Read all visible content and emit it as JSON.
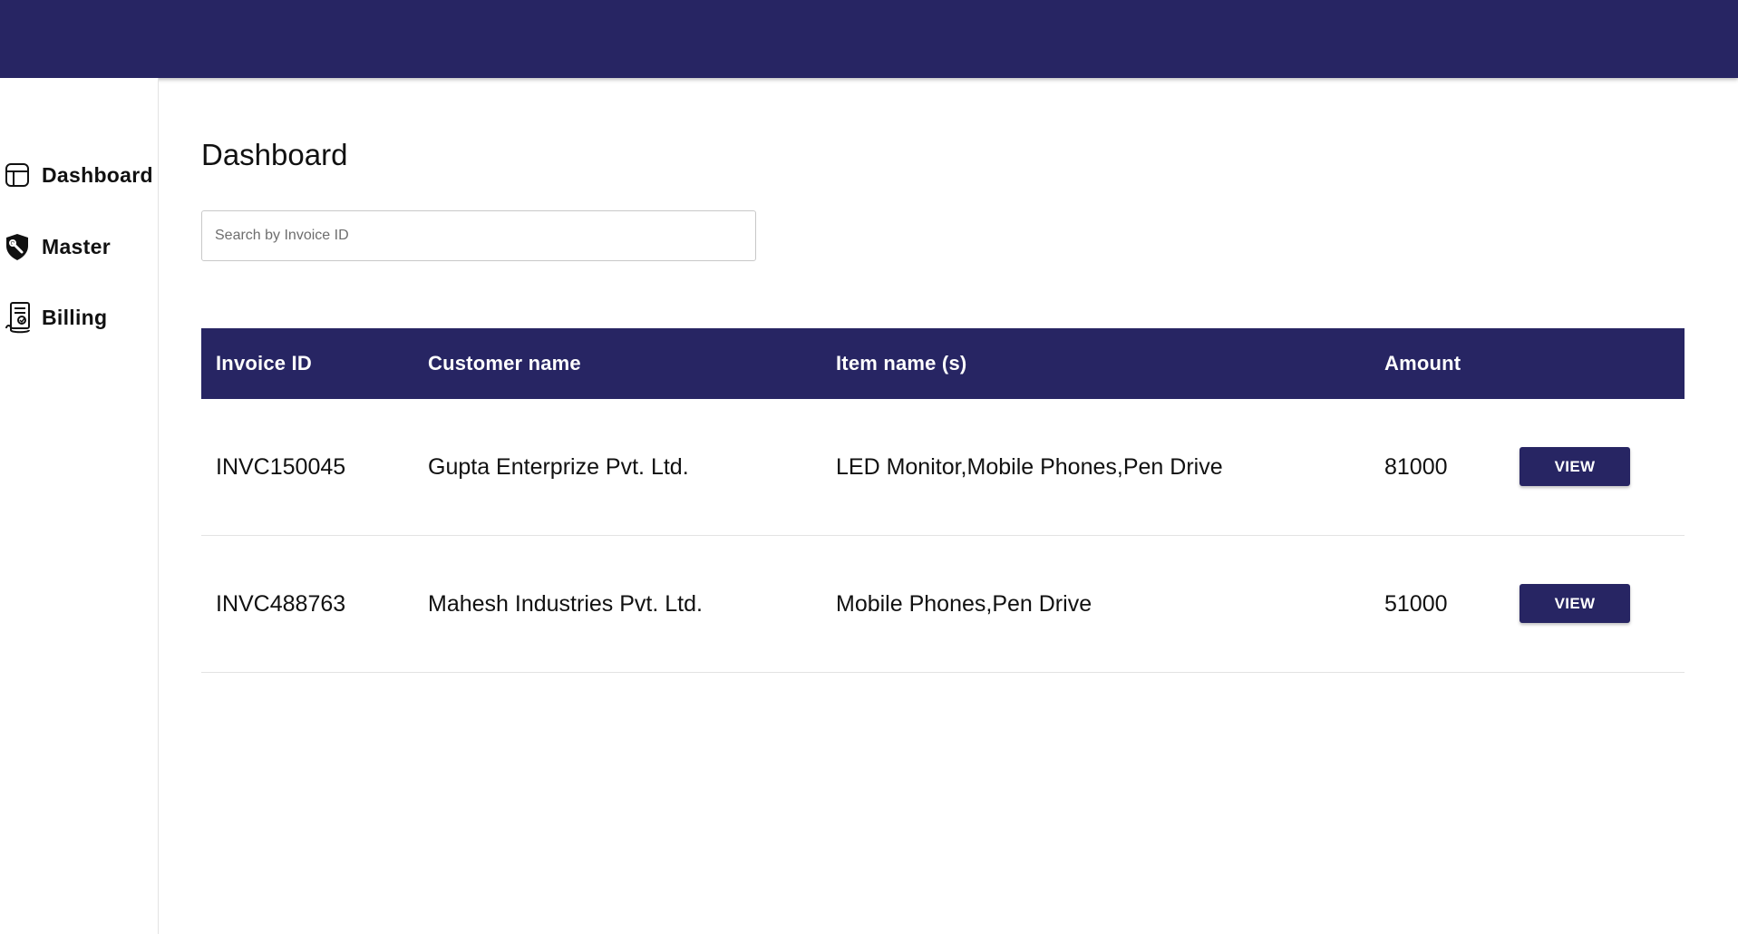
{
  "sidebar": {
    "items": [
      {
        "label": "Dashboard",
        "icon": "layout-icon"
      },
      {
        "label": "Master",
        "icon": "shield-icon"
      },
      {
        "label": "Billing",
        "icon": "receipt-icon"
      }
    ]
  },
  "main": {
    "title": "Dashboard",
    "search": {
      "placeholder": "Search by Invoice ID",
      "value": ""
    },
    "table": {
      "headers": [
        "Invoice ID",
        "Customer name",
        "Item name (s)",
        "Amount"
      ],
      "rows": [
        {
          "invoice_id": "INVC150045",
          "customer": "Gupta Enterprize Pvt. Ltd.",
          "items": "LED Monitor,Mobile Phones,Pen Drive",
          "amount": "81000",
          "action": "VIEW"
        },
        {
          "invoice_id": "INVC488763",
          "customer": "Mahesh Industries Pvt. Ltd.",
          "items": "Mobile Phones,Pen Drive",
          "amount": "51000",
          "action": "VIEW"
        }
      ]
    }
  },
  "colors": {
    "primary": "#272563",
    "divider": "#e3e3e3",
    "text": "#111111"
  }
}
